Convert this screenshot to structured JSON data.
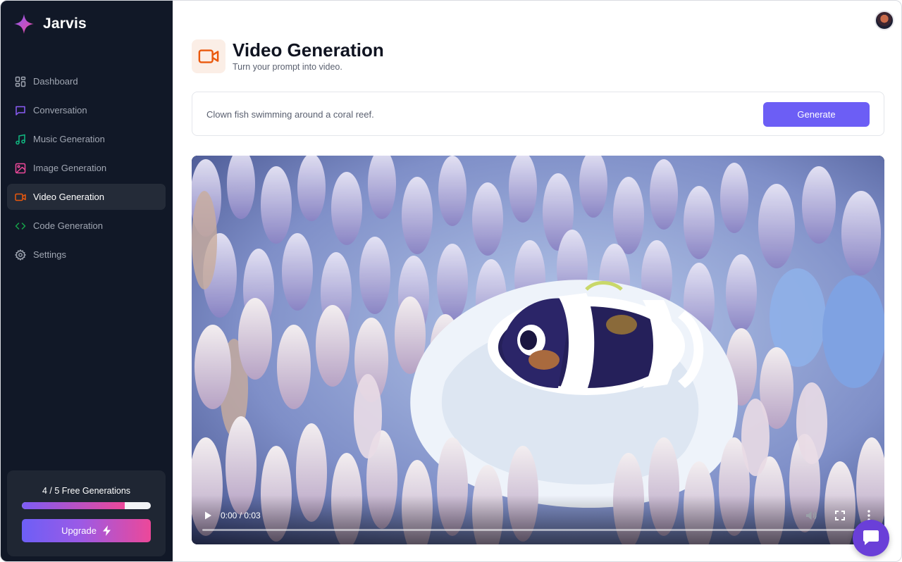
{
  "app": {
    "name": "Jarvis",
    "accent": "#6c5ef5"
  },
  "sidebar": {
    "items": [
      {
        "label": "Dashboard",
        "icon": "dashboard-icon",
        "color": "#a1a7b3"
      },
      {
        "label": "Conversation",
        "icon": "message-square-icon",
        "color": "#8b5cf6"
      },
      {
        "label": "Music Generation",
        "icon": "music-icon",
        "color": "#10b981"
      },
      {
        "label": "Image Generation",
        "icon": "image-icon",
        "color": "#ec4899"
      },
      {
        "label": "Video Generation",
        "icon": "video-icon",
        "color": "#ea580c",
        "active": true
      },
      {
        "label": "Code Generation",
        "icon": "code-icon",
        "color": "#16a34a"
      },
      {
        "label": "Settings",
        "icon": "settings-icon",
        "color": "#a1a7b3"
      }
    ],
    "usage": {
      "text": "4 / 5 Free Generations",
      "used": 4,
      "limit": 5
    },
    "upgrade_label": "Upgrade"
  },
  "header": {
    "title": "Video Generation",
    "subtitle": "Turn your prompt into video.",
    "icon": "video-icon",
    "icon_color": "#ea580c"
  },
  "prompt": {
    "value": "Clown fish swimming around a coral reef.",
    "button_label": "Generate"
  },
  "video": {
    "time": "0:00 / 0:03",
    "progress": 0
  }
}
